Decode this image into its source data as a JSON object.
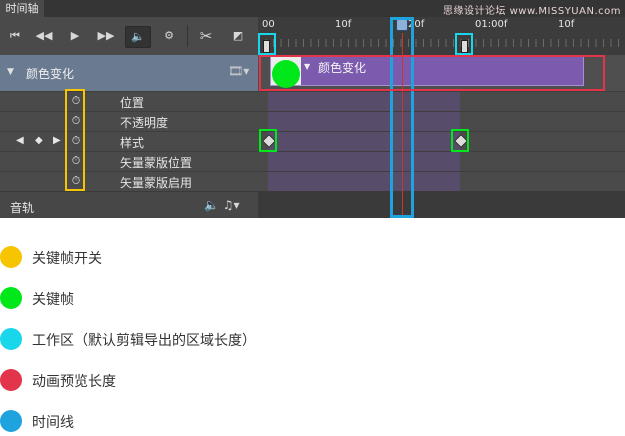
{
  "panel": {
    "tab_label": "时间轴",
    "watermark": "思缘设计论坛 www.MISSYUAN.com"
  },
  "toolbar": {
    "first_frame": "⏮",
    "prev_frame": "◀◀",
    "play": "▶",
    "next_frame": "▶▶",
    "audio": "🔈",
    "settings": "⚙",
    "split": "✂",
    "transition": "◩"
  },
  "ruler": {
    "labels": [
      "00",
      "10f",
      "20f",
      "01:00f",
      "10f"
    ]
  },
  "layer": {
    "name": "颜色变化",
    "clip_label": "颜色变化"
  },
  "properties": [
    "位置",
    "不透明度",
    "样式",
    "矢量蒙版位置",
    "矢量蒙版启用"
  ],
  "audio_track": {
    "label": "音轨"
  },
  "legend": [
    {
      "color": "#f7c400",
      "text": "关键帧开关"
    },
    {
      "color": "#00e81a",
      "text": "关键帧"
    },
    {
      "color": "#19d7ea",
      "text": "工作区（默认剪辑导出的区域长度）"
    },
    {
      "color": "#e2344b",
      "text": "动画预览长度"
    },
    {
      "color": "#1ea3df",
      "text": "时间线"
    }
  ]
}
